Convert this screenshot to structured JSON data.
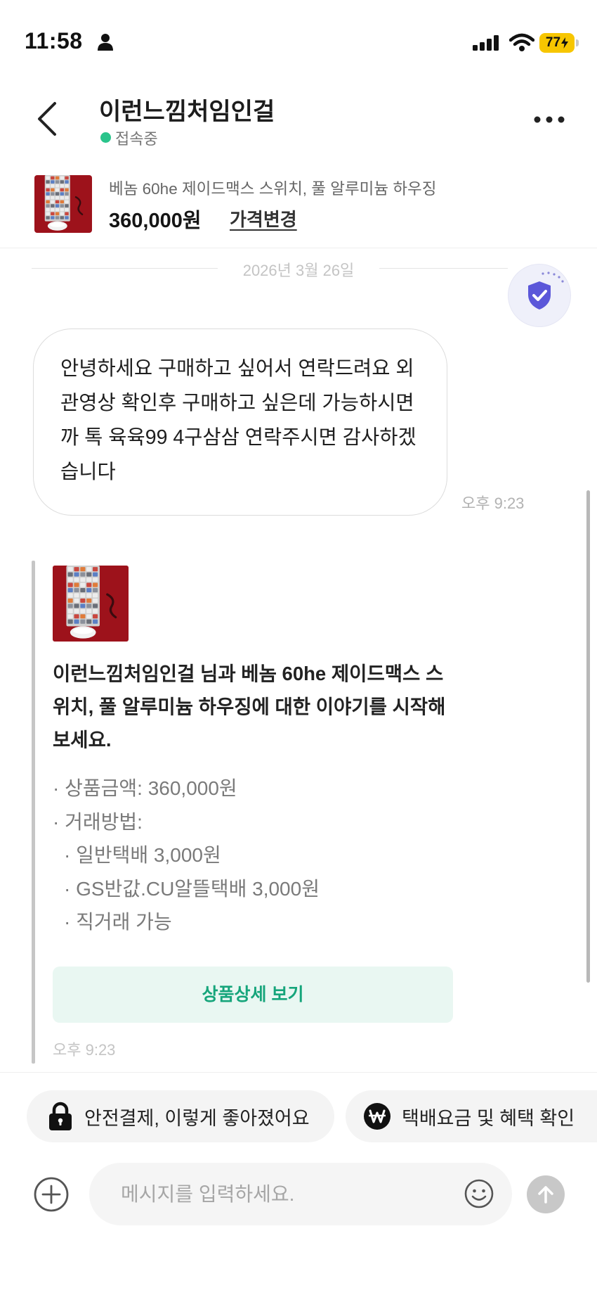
{
  "status_bar": {
    "time": "11:58",
    "battery_level": "77",
    "icons": [
      "person-icon",
      "signal-icon",
      "wifi-icon",
      "battery-charging-icon"
    ]
  },
  "header": {
    "back_icon": "chevron-left-icon",
    "title": "이런느낌처임인걸",
    "status": "접속중",
    "more_icon": "more-horizontal-icon"
  },
  "product": {
    "title": "베놈 60he 제이드맥스 스위치, 풀 알루미늄 하우징",
    "price": "360,000원",
    "price_change_link": "가격변경"
  },
  "chat": {
    "date": "2026년 3월 26일",
    "safety_icon": "shield-check-icon",
    "messages": [
      {
        "text": "안녕하세요 구매하고 싶어서 연락드려요 외관영상 확인후 구매하고 싶은데 가능하시면 까 톡 육육99 4구삼삼 연락주시면 감사하겠습니다",
        "time": "오후 9:23"
      }
    ],
    "system_card": {
      "intro": "이런느낌처임인걸 님과 베놈 60he 제이드맥스 스위치, 풀 알루미늄 하우징에 대한 이야기를 시작해보세요.",
      "details": [
        {
          "text": "· 상품금액: 360,000원"
        },
        {
          "text": "· 거래방법:",
          "sub": [
            "· 일반택배 3,000원",
            "· GS반값.CU알뜰택배 3,000원",
            "· 직거래 가능"
          ]
        }
      ],
      "button": "상품상세 보기",
      "time": "오후 9:23"
    }
  },
  "quick_chips": [
    {
      "icon": "lock-icon",
      "label": "안전결제, 이렇게 좋아졌어요"
    },
    {
      "icon": "won-icon",
      "label": "택배요금 및 혜택 확인"
    }
  ],
  "composer": {
    "add_icon": "plus-circle-icon",
    "placeholder": "메시지를 입력하세요.",
    "emoji_icon": "smile-icon",
    "send_icon": "arrow-up-icon"
  },
  "colors": {
    "accent": "#16a57b",
    "button_bg": "#e9f7f2",
    "online": "#2ac48b",
    "shield": "#5b57d9",
    "shield_bg": "#eff0fa",
    "battery": "#f7c600"
  }
}
